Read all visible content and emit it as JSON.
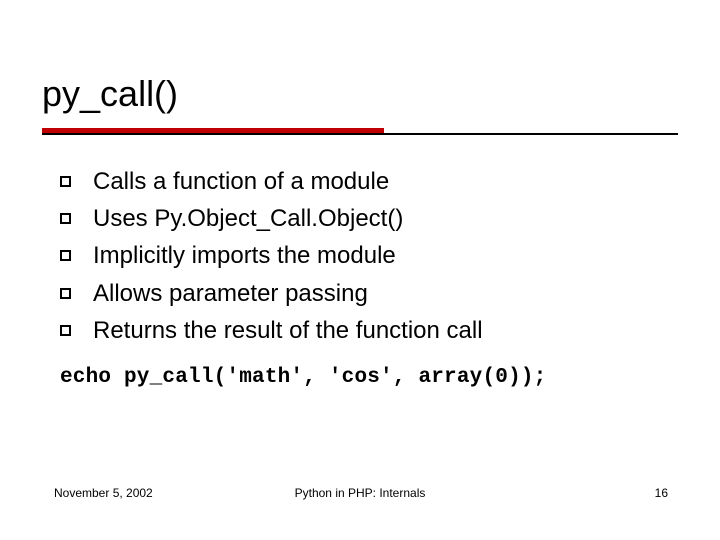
{
  "title": "py_call()",
  "bullets": [
    "Calls a function of a module",
    "Uses Py.Object_Call.Object()",
    "Implicitly imports the module",
    "Allows parameter passing",
    "Returns the result of the function call"
  ],
  "code": "echo py_call('math', 'cos', array(0));",
  "footer": {
    "date": "November 5, 2002",
    "center": "Python in PHP: Internals",
    "page": "16"
  }
}
